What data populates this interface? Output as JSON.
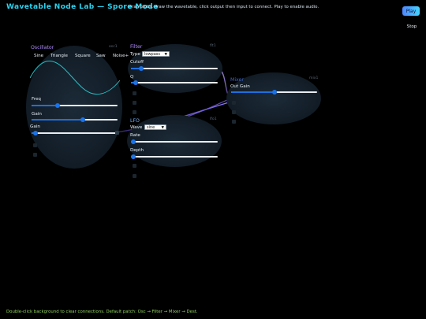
{
  "header": {
    "title": "Wavetable Node Lab — Spore Mode",
    "hint": "Drag blobs, draw the wavetable, click output then input to connect. Play to enable audio.",
    "play_label": "Play",
    "stop_label": "Stop"
  },
  "colors": {
    "title": "#29d3f0",
    "osc_title": "#b18cff",
    "filter_title": "#b18cff",
    "lfo_title": "#6fb4ff",
    "mixer_title": "#3f66c8",
    "wire_light": "#b89cff",
    "wire_dark": "#3a2a78",
    "slider_accent": "#1b73e8",
    "footer": "#8fd45a"
  },
  "nodes": {
    "osc": {
      "title": "Oscillator",
      "id": "osc1",
      "wave_buttons": [
        "Sine",
        "Triangle",
        "Square",
        "Saw",
        "Noise"
      ],
      "noise_extra": "+",
      "freq_label": "Freq",
      "freq_value": 0.3,
      "gain_label": "Gain",
      "gain_value": 0.6,
      "gain2_label": "Gain",
      "gain2_value": 0.05
    },
    "filter": {
      "title": "Filter",
      "id": "flt1",
      "type_label": "Type",
      "type_value": "lowpass",
      "cutoff_label": "Cutoff",
      "cutoff_value": 0.12,
      "q_label": "Q",
      "q_value": 0.05
    },
    "mixer": {
      "title": "Mixer",
      "id": "mix1",
      "out_gain_label": "Out Gain",
      "out_gain_value": 0.5
    },
    "lfo": {
      "title": "LFO",
      "id": "lfo1",
      "wave_label": "Wave",
      "wave_value": "sine",
      "rate_label": "Rate",
      "rate_value": 0.03,
      "depth_label": "Depth",
      "depth_value": 0.03
    }
  },
  "footer": "Double-click background to clear connections. Default patch: Osc → Filter → Mixer → Dest."
}
